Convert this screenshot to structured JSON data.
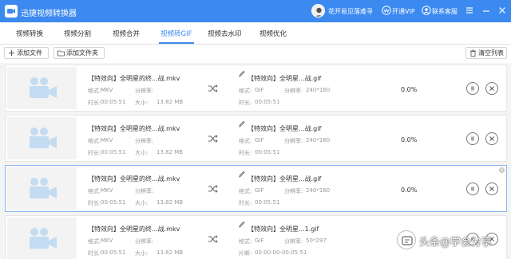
{
  "app": {
    "title": "迅捷视频转换器"
  },
  "header": {
    "user_name": "花开易见落难寻",
    "vip_label": "开通VIP",
    "support_label": "联系客服"
  },
  "tabs": [
    {
      "label": "视频转换"
    },
    {
      "label": "视频分割"
    },
    {
      "label": "视频合并"
    },
    {
      "label": "视频转GIF"
    },
    {
      "label": "视频去水印"
    },
    {
      "label": "视频优化"
    }
  ],
  "active_tab": "视频转GIF",
  "toolbar": {
    "add_file": "添加文件",
    "add_folder": "添加文件夹",
    "clear_list": "清空列表"
  },
  "labels": {
    "format": "格式:",
    "resolution": "分辨率:",
    "duration": "时长:",
    "size": "大小:",
    "clip": "片断:"
  },
  "rows": [
    {
      "src_name": "【特效向】全明星的终...战.mkv",
      "src_format": "MKV",
      "src_duration": "00:05:51",
      "src_size": "13.82 MB",
      "dst_name": "【特效向】全明星...战.gif",
      "dst_format": "GIF",
      "dst_resolution": "240*160",
      "dst_time_label": "时长:",
      "dst_time": "00:05:51",
      "progress": "0.0%"
    },
    {
      "src_name": "【特效向】全明星的终...战.mkv",
      "src_format": "MKV",
      "src_duration": "00:05:51",
      "src_size": "13.82 MB",
      "dst_name": "【特效向】全明星...战.gif",
      "dst_format": "GIF",
      "dst_resolution": "240*160",
      "dst_time_label": "时长:",
      "dst_time": "00:05:51",
      "progress": "0.0%"
    },
    {
      "src_name": "【特效向】全明星的终...战.mkv",
      "src_format": "MKV",
      "src_duration": "00:05:51",
      "src_size": "13.82 MB",
      "dst_name": "【特效向】全明星...战.gif",
      "dst_format": "GIF",
      "dst_resolution": "240*160",
      "dst_time_label": "时长:",
      "dst_time": "00:05:51",
      "progress": "0.0%"
    },
    {
      "src_name": "【特效向】全明星的终...战.mkv",
      "src_format": "MKV",
      "src_duration": "00:05:51",
      "src_size": "13.82 MB",
      "dst_name": "【特效向】全明星...1.gif",
      "dst_format": "GIF",
      "dst_resolution": "50*297",
      "dst_time_label": "片断:",
      "dst_time": "00:00:00-00:05:51",
      "progress": ""
    }
  ],
  "watermark": {
    "text": "头条@学会分享"
  },
  "colors": {
    "accent": "#3c8af0"
  }
}
